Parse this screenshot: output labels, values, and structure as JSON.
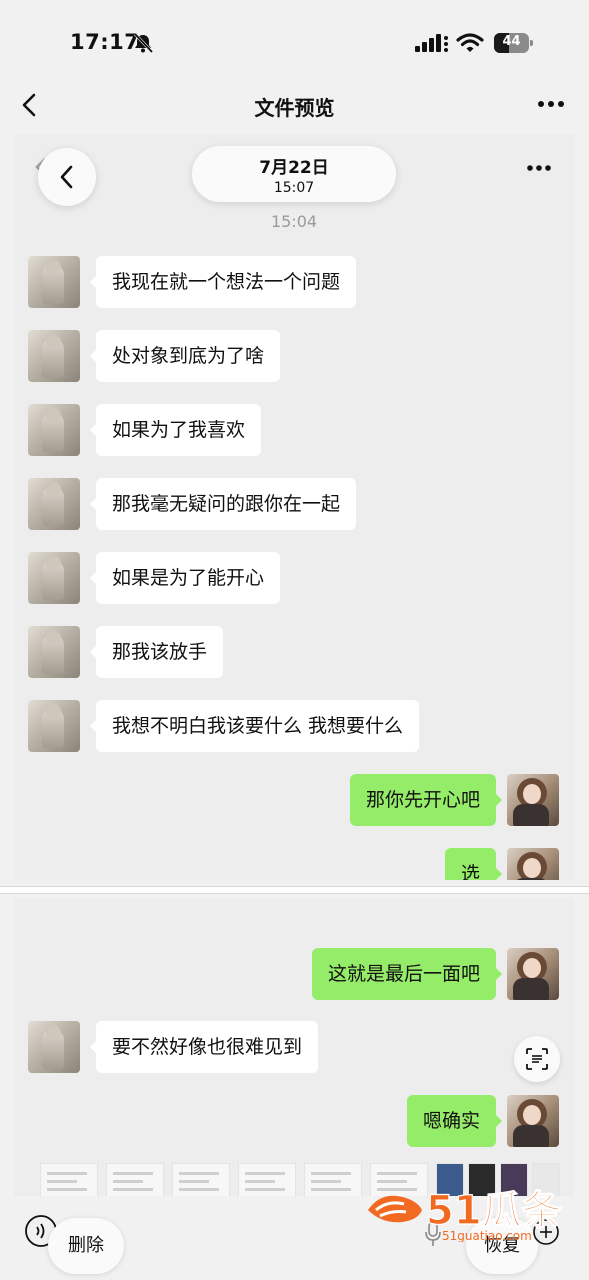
{
  "status_bar": {
    "time": "17:17",
    "battery": "44",
    "battery_percent": 44
  },
  "nav": {
    "title": "文件预览"
  },
  "panel_top": {
    "date_main": "7月22日",
    "date_sub": "15:07",
    "chat_time": "15:04",
    "messages": [
      {
        "side": "left",
        "text": "我现在就一个想法一个问题"
      },
      {
        "side": "left",
        "text": "处对象到底为了啥"
      },
      {
        "side": "left",
        "text": "如果为了我喜欢"
      },
      {
        "side": "left",
        "text": "那我毫无疑问的跟你在一起"
      },
      {
        "side": "left",
        "text": "如果是为了能开心"
      },
      {
        "side": "left",
        "text": "那我该放手"
      },
      {
        "side": "left",
        "text": "我想不明白我该要什么 我想要什么"
      },
      {
        "side": "right",
        "text": "那你先开心吧"
      },
      {
        "side": "right",
        "text": "选"
      }
    ]
  },
  "panel_bottom": {
    "messages": [
      {
        "side": "right",
        "text": "这就是最后一面吧"
      },
      {
        "side": "left",
        "text": "要不然好像也很难见到"
      },
      {
        "side": "right",
        "text": "嗯确实"
      }
    ]
  },
  "bottom_bar": {
    "delete_label": "删除",
    "restore_label": "恢复"
  },
  "watermark": {
    "brand": "51瓜条",
    "domain": "51guatiao.com"
  },
  "colors": {
    "green_bubble": "#95ec69",
    "white_bubble": "#ffffff",
    "chat_bg": "#ededed",
    "watermark": "#f26a21"
  }
}
